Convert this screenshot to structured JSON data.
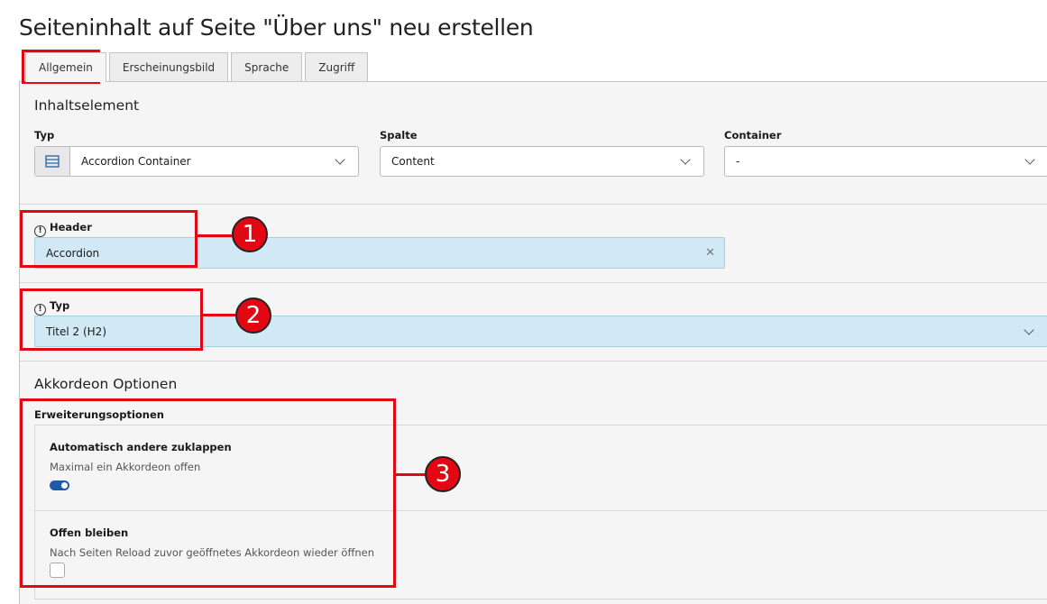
{
  "page": {
    "title": "Seiteninhalt auf Seite \"Über uns\" neu erstellen"
  },
  "tabs": [
    {
      "label": "Allgemein",
      "active": true
    },
    {
      "label": "Erscheinungsbild",
      "active": false
    },
    {
      "label": "Sprache",
      "active": false
    },
    {
      "label": "Zugriff",
      "active": false
    }
  ],
  "content_element": {
    "section_title": "Inhaltselement",
    "type": {
      "label": "Typ",
      "value": "Accordion Container",
      "icon": "content-element-icon"
    },
    "column": {
      "label": "Spalte",
      "value": "Content"
    },
    "container": {
      "label": "Container",
      "value": "-"
    }
  },
  "header": {
    "label": "Header",
    "value": "Accordion",
    "icon": "warning-icon"
  },
  "header_type": {
    "label": "Typ",
    "value": "Titel 2 (H2)",
    "icon": "warning-icon"
  },
  "accordion": {
    "section_title": "Akkordeon Optionen",
    "group_label": "Erweiterungsoptionen",
    "options": [
      {
        "title": "Automatisch andere zuklappen",
        "description": "Maximal ein Akkordeon offen",
        "enabled": true
      },
      {
        "title": "Offen bleiben",
        "description": "Nach Seiten Reload zuvor geöffnetes Akkordeon wieder öffnen",
        "enabled": false
      }
    ]
  },
  "annotations": {
    "one": "1",
    "two": "2",
    "three": "3",
    "color": "#e30613"
  },
  "colors": {
    "highlight_field": "#d0e9f5",
    "toggle_on": "#1e5aa8"
  }
}
